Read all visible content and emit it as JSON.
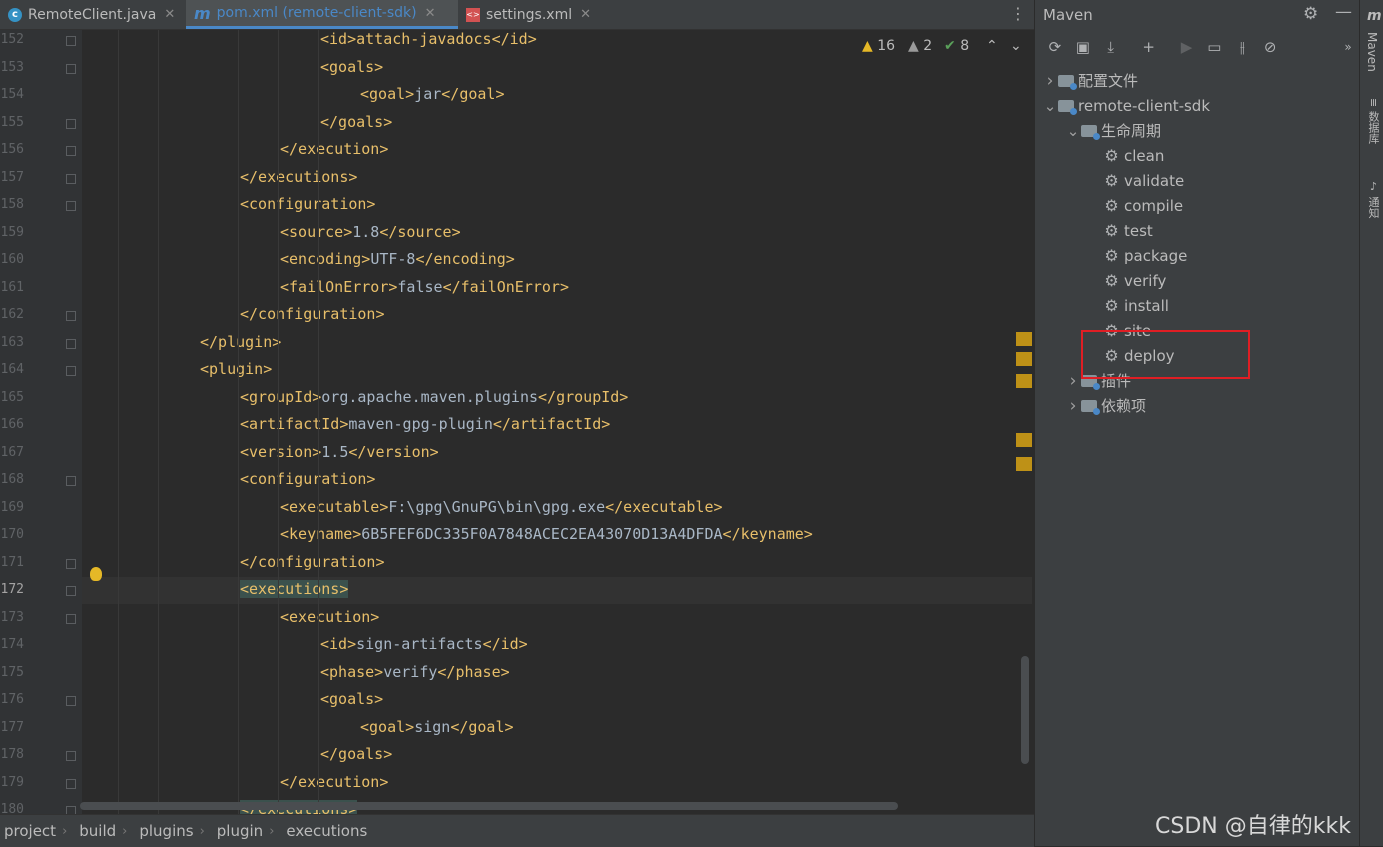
{
  "tabs": [
    {
      "label": "RemoteClient.java",
      "icon": "java-class-icon"
    },
    {
      "label": "pom.xml (remote-client-sdk)",
      "icon": "maven-icon"
    },
    {
      "label": "settings.xml",
      "icon": "xml-icon"
    }
  ],
  "inspections": {
    "warnings": "16",
    "weak_warnings": "2",
    "typos": "8"
  },
  "code_lines": [
    {
      "n": "152",
      "indent": 3,
      "tag": "<id>attach-javadocs</id>",
      "text": ""
    },
    {
      "n": "153",
      "indent": 3,
      "tag": "<goals>",
      "text": ""
    },
    {
      "n": "154",
      "indent": 4,
      "tag": "<goal>",
      "text": "jar",
      "close": "</goal>"
    },
    {
      "n": "155",
      "indent": 3,
      "tag": "</goals>",
      "text": ""
    },
    {
      "n": "156",
      "indent": 2,
      "tag": "</execution>",
      "text": ""
    },
    {
      "n": "157",
      "indent": 1,
      "tag": "</executions>",
      "text": ""
    },
    {
      "n": "158",
      "indent": 1,
      "tag": "<configuration>",
      "text": ""
    },
    {
      "n": "159",
      "indent": 2,
      "tag": "<source>",
      "text": "1.8",
      "close": "</source>"
    },
    {
      "n": "160",
      "indent": 2,
      "tag": "<encoding>",
      "text": "UTF-8",
      "close": "</encoding>"
    },
    {
      "n": "161",
      "indent": 2,
      "tag": "<failOnError>",
      "text": "false",
      "close": "</failOnError>"
    },
    {
      "n": "162",
      "indent": 1,
      "tag": "</configuration>",
      "text": ""
    },
    {
      "n": "163",
      "indent": 0,
      "tag": "</plugin>",
      "text": ""
    },
    {
      "n": "164",
      "indent": 0,
      "tag": "<plugin>",
      "text": ""
    },
    {
      "n": "165",
      "indent": 1,
      "tag": "<groupId>",
      "text": "org.apache.maven.plugins",
      "close": "</groupId>"
    },
    {
      "n": "166",
      "indent": 1,
      "tag": "<artifactId>",
      "text": "maven-gpg-plugin",
      "close": "</artifactId>"
    },
    {
      "n": "167",
      "indent": 1,
      "tag": "<version>",
      "text": "1.5",
      "close": "</version>"
    },
    {
      "n": "168",
      "indent": 1,
      "tag": "<configuration>",
      "text": ""
    },
    {
      "n": "169",
      "indent": 2,
      "tag": "<executable>",
      "text": "F:\\gpg\\GnuPG\\bin\\gpg.exe",
      "close": "</executable>"
    },
    {
      "n": "170",
      "indent": 2,
      "tag": "<keyname>",
      "text": "6B5FEF6DC335F0A7848ACEC2EA43070D13A4DFDA",
      "close": "</keyname>"
    },
    {
      "n": "171",
      "indent": 1,
      "tag": "</configuration>",
      "text": ""
    },
    {
      "n": "172",
      "indent": 1,
      "tag": "<executions>",
      "text": "",
      "current": true
    },
    {
      "n": "173",
      "indent": 2,
      "tag": "<execution>",
      "text": ""
    },
    {
      "n": "174",
      "indent": 3,
      "tag": "<id>",
      "text": "sign-artifacts",
      "close": "</id>"
    },
    {
      "n": "175",
      "indent": 3,
      "tag": "<phase>",
      "text": "verify",
      "close": "</phase>"
    },
    {
      "n": "176",
      "indent": 3,
      "tag": "<goals>",
      "text": ""
    },
    {
      "n": "177",
      "indent": 4,
      "tag": "<goal>",
      "text": "sign",
      "close": "</goal>"
    },
    {
      "n": "178",
      "indent": 3,
      "tag": "</goals>",
      "text": ""
    },
    {
      "n": "179",
      "indent": 2,
      "tag": "</execution>",
      "text": ""
    },
    {
      "n": "180",
      "indent": 1,
      "tag": "</executions>",
      "text": "",
      "matched": true
    }
  ],
  "breadcrumb": [
    "project",
    "build",
    "plugins",
    "plugin",
    "executions"
  ],
  "maven": {
    "title": "Maven",
    "tree": [
      {
        "label": "配置文件",
        "depth": 0,
        "expander": "collapsed",
        "icon": "profiles-icon"
      },
      {
        "label": "remote-client-sdk",
        "depth": 0,
        "expander": "expanded",
        "icon": "maven-project-icon"
      },
      {
        "label": "生命周期",
        "depth": 1,
        "expander": "expanded",
        "icon": "lifecycle-folder-icon"
      },
      {
        "label": "clean",
        "depth": 2,
        "icon": "gear-icon"
      },
      {
        "label": "validate",
        "depth": 2,
        "icon": "gear-icon"
      },
      {
        "label": "compile",
        "depth": 2,
        "icon": "gear-icon"
      },
      {
        "label": "test",
        "depth": 2,
        "icon": "gear-icon"
      },
      {
        "label": "package",
        "depth": 2,
        "icon": "gear-icon"
      },
      {
        "label": "verify",
        "depth": 2,
        "icon": "gear-icon"
      },
      {
        "label": "install",
        "depth": 2,
        "icon": "gear-icon"
      },
      {
        "label": "site",
        "depth": 2,
        "icon": "gear-icon"
      },
      {
        "label": "deploy",
        "depth": 2,
        "icon": "gear-icon"
      },
      {
        "label": "插件",
        "depth": 1,
        "expander": "collapsed",
        "icon": "plugins-folder-icon"
      },
      {
        "label": "依赖项",
        "depth": 1,
        "expander": "collapsed",
        "icon": "dependencies-folder-icon"
      }
    ]
  },
  "side_tabs": [
    "Maven",
    "数据库",
    "通知"
  ],
  "watermark": "CSDN @自律的kkk",
  "colors": {
    "accent": "#4a88c7",
    "highlight_box": "#e01e24",
    "tag": "#e8bf6a",
    "text": "#a9b7c6"
  }
}
